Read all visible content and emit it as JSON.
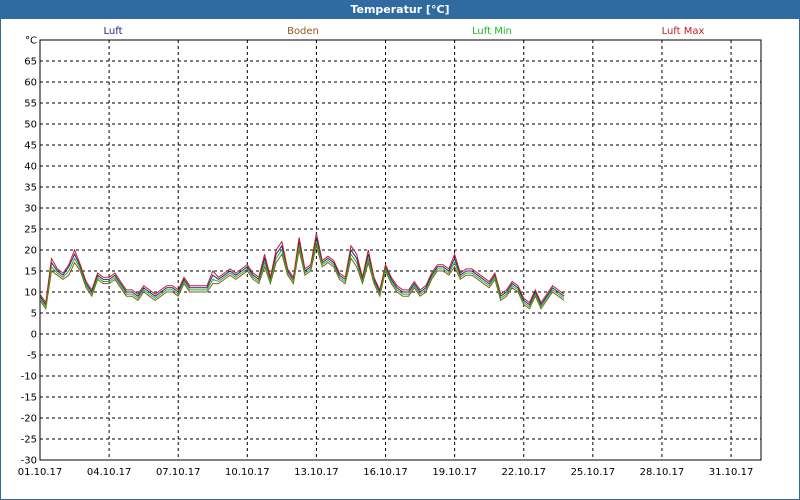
{
  "window": {
    "title": "Temperatur [°C]"
  },
  "chart_data": {
    "type": "line",
    "title": "Temperatur [°C]",
    "ylabel": "°C",
    "ylim": [
      -30,
      70
    ],
    "yticks": [
      "°C",
      "65",
      "60",
      "55",
      "50",
      "45",
      "40",
      "35",
      "30",
      "25",
      "20",
      "15",
      "10",
      "5",
      "0",
      "-5",
      "-10",
      "-15",
      "-20",
      "-25",
      "-30"
    ],
    "xlim": [
      0,
      31.3
    ],
    "xticks": [
      {
        "label": "01.10.17",
        "day": 0
      },
      {
        "label": "04.10.17",
        "day": 3
      },
      {
        "label": "07.10.17",
        "day": 6
      },
      {
        "label": "10.10.17",
        "day": 9
      },
      {
        "label": "13.10.17",
        "day": 12
      },
      {
        "label": "16.10.17",
        "day": 15
      },
      {
        "label": "19.10.17",
        "day": 18
      },
      {
        "label": "22.10.17",
        "day": 21
      },
      {
        "label": "25.10.17",
        "day": 24
      },
      {
        "label": "28.10.17",
        "day": 27
      },
      {
        "label": "31.10.17",
        "day": 30
      }
    ],
    "grid": true,
    "legend_position": "top",
    "x": [
      0,
      0.25,
      0.5,
      0.75,
      1,
      1.25,
      1.5,
      1.75,
      2,
      2.25,
      2.5,
      2.75,
      3,
      3.25,
      3.5,
      3.75,
      4,
      4.25,
      4.5,
      4.75,
      5,
      5.25,
      5.5,
      5.75,
      6,
      6.25,
      6.5,
      6.75,
      7,
      7.25,
      7.5,
      7.75,
      8,
      8.25,
      8.5,
      8.75,
      9,
      9.25,
      9.5,
      9.75,
      10,
      10.25,
      10.5,
      10.75,
      11,
      11.25,
      11.5,
      11.75,
      12,
      12.25,
      12.5,
      12.75,
      13,
      13.25,
      13.5,
      13.75,
      14,
      14.25,
      14.5,
      14.75,
      15,
      15.25,
      15.5,
      15.75,
      16,
      16.25,
      16.5,
      16.75,
      17,
      17.25,
      17.5,
      17.75,
      18,
      18.25,
      18.5,
      18.75,
      19,
      19.25,
      19.5,
      19.75,
      20,
      20.25,
      20.5,
      20.75,
      21,
      21.25,
      21.5,
      21.75,
      22,
      22.25,
      22.5,
      22.75,
      23,
      23.25,
      23.5,
      23.75,
      24,
      24.25,
      24.5,
      24.75,
      25,
      25.25,
      25.5,
      25.75,
      26,
      26.25,
      26.5,
      26.75,
      27,
      27.25,
      27.5,
      27.75,
      28,
      28.25,
      28.5,
      28.75,
      29,
      29.25,
      29.5,
      29.75,
      30,
      30.25,
      30.5,
      30.75,
      31,
      31.25
    ],
    "series": [
      {
        "name": "Luft",
        "color": "#1f1f9e",
        "values": [
          9,
          7,
          17,
          15,
          14,
          16,
          19,
          16,
          12,
          10,
          14,
          13,
          13,
          14,
          12,
          10,
          10,
          9,
          11,
          10,
          9,
          10,
          11,
          11,
          10,
          13,
          11,
          11,
          11,
          11,
          14,
          13,
          14,
          15,
          14,
          15,
          16,
          14,
          13,
          18,
          13,
          19,
          21,
          15,
          13,
          22,
          15,
          16,
          23,
          17,
          18,
          17,
          14,
          13,
          20,
          18,
          13,
          19,
          13,
          10,
          16,
          13,
          11,
          10,
          10,
          12,
          10,
          11,
          14,
          16,
          16,
          15,
          18,
          14,
          15,
          15,
          14,
          13,
          12,
          14,
          9,
          10,
          12,
          11,
          8,
          7,
          10,
          7,
          9,
          11,
          10,
          9
        ]
      },
      {
        "name": "Boden",
        "color": "#8b5a1e",
        "values": [
          8,
          6,
          15,
          14,
          13,
          14,
          17,
          15,
          11,
          9,
          13,
          12,
          12,
          13,
          11,
          9,
          9,
          8,
          10,
          9,
          8,
          9,
          10,
          10,
          9,
          12,
          10,
          10,
          10,
          10,
          12,
          12,
          13,
          14,
          13,
          14,
          15,
          13,
          12,
          16,
          12,
          17,
          19,
          14,
          12,
          20,
          14,
          15,
          21,
          16,
          17,
          16,
          13,
          12,
          18,
          16,
          12,
          17,
          12,
          9,
          15,
          12,
          10,
          9,
          9,
          11,
          9,
          10,
          13,
          15,
          15,
          14,
          16,
          13,
          14,
          14,
          13,
          12,
          11,
          13,
          8,
          9,
          11,
          10,
          7,
          6,
          9,
          6,
          8,
          10,
          9,
          8
        ]
      },
      {
        "name": "Luft Min",
        "color": "#1fb81f",
        "values": [
          8.5,
          6.5,
          16,
          14.5,
          13.5,
          15,
          18,
          15.5,
          11.5,
          9.5,
          13.5,
          12.5,
          12.5,
          13.5,
          11.5,
          9.5,
          9.5,
          8.5,
          10.5,
          9.5,
          8.5,
          9.5,
          10.5,
          10.5,
          9.5,
          12.5,
          10.5,
          10.5,
          10.5,
          10.5,
          13,
          12.5,
          13.5,
          14.5,
          13.5,
          14.5,
          15.5,
          13.5,
          12.5,
          17,
          12.5,
          18,
          20,
          14.5,
          12.5,
          21,
          14.5,
          15.5,
          22,
          16.5,
          17.5,
          16.5,
          13.5,
          12.5,
          19,
          17,
          12.5,
          18,
          12.5,
          9.5,
          15.5,
          12.5,
          10.5,
          9.5,
          9.5,
          11.5,
          9.5,
          10.5,
          13.5,
          15.5,
          15.5,
          14.5,
          17,
          13.5,
          14.5,
          14.5,
          13.5,
          12.5,
          11.5,
          13.5,
          8.5,
          9.5,
          11.5,
          10.5,
          7.5,
          6.5,
          9.5,
          6.5,
          8.5,
          10.5,
          9.5,
          8.5
        ]
      },
      {
        "name": "Luft Max",
        "color": "#c81e1e",
        "values": [
          9.5,
          7.5,
          18,
          15.5,
          14.5,
          16.5,
          20,
          16.5,
          12.5,
          10.5,
          14.5,
          13.5,
          13.5,
          14.5,
          12.5,
          10.5,
          10.5,
          9.5,
          11.5,
          10.5,
          9.5,
          10.5,
          11.5,
          11.5,
          10.5,
          13.5,
          11.5,
          11.5,
          11.5,
          11.5,
          15,
          13.5,
          14.5,
          15.5,
          14.5,
          15.5,
          16.5,
          14.5,
          13.5,
          19,
          13.5,
          20,
          22,
          15.5,
          13.5,
          23,
          15.5,
          16.5,
          24,
          17.5,
          18.5,
          17.5,
          14.5,
          13.5,
          21,
          19,
          13.5,
          20,
          13.5,
          10.5,
          16.5,
          13.5,
          11.5,
          10.5,
          10.5,
          12.5,
          10.5,
          11.5,
          14.5,
          16.5,
          16.5,
          15.5,
          19,
          14.5,
          15.5,
          15.5,
          14.5,
          13.5,
          12.5,
          14.5,
          9.5,
          10.5,
          12.5,
          11.5,
          8.5,
          7.5,
          10.5,
          7.5,
          9.5,
          11.5,
          10.5,
          9.5
        ]
      }
    ]
  }
}
